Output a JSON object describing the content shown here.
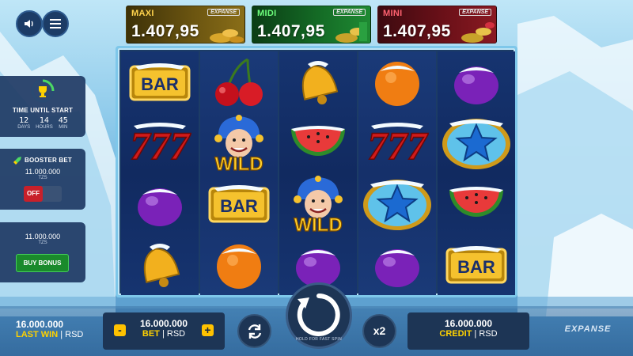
{
  "jackpots": {
    "maxi": {
      "name": "MAXI",
      "value": "1.407,95",
      "brand": "EXPANSE"
    },
    "midi": {
      "name": "MIDI",
      "value": "1.407,95",
      "brand": "EXPANSE"
    },
    "mini": {
      "name": "MINI",
      "value": "1.407,95",
      "brand": "EXPANSE"
    }
  },
  "timer": {
    "title": "TIME UNTIL START",
    "days": "12",
    "hours": "14",
    "min": "45",
    "days_label": "DAYS",
    "hours_label": "HOURS",
    "min_label": "MIN"
  },
  "booster": {
    "title": "BOOSTER BET",
    "amount": "11.000.000",
    "currency": "TZS",
    "toggle": "OFF"
  },
  "buy_bonus": {
    "amount": "11.000.000",
    "currency": "TZS",
    "button": "BUY BONUS"
  },
  "reels": [
    [
      "bar",
      "seven",
      "plum",
      "bell"
    ],
    [
      "cherry",
      "wild",
      "bar",
      "orange"
    ],
    [
      "bell",
      "watermelon",
      "wild",
      "plum"
    ],
    [
      "orange",
      "seven",
      "star",
      "plum"
    ],
    [
      "plum",
      "star",
      "watermelon",
      "bar"
    ]
  ],
  "symbol_text": {
    "bar": "BAR",
    "seven": "777",
    "wild": "WILD"
  },
  "bottom": {
    "last_win_amount": "16.000.000",
    "last_win_label": "LAST WIN",
    "bet_amount": "16.000.000",
    "bet_label": "BET",
    "credit_amount": "16.000.000",
    "credit_label": "CREDIT",
    "currency": "RSD",
    "separator": "|",
    "minus": "-",
    "plus": "+",
    "multiplier": "x2",
    "spin_hint": "HOLD FOR FAST SPIN",
    "brand": "EXPANSE"
  },
  "icons": {
    "sound": "speaker-icon",
    "menu": "hamburger-icon",
    "timer": "trophy-icon",
    "booster": "rocket-icon",
    "autoplay": "refresh-icon",
    "spin": "spin-arrow-icon"
  }
}
